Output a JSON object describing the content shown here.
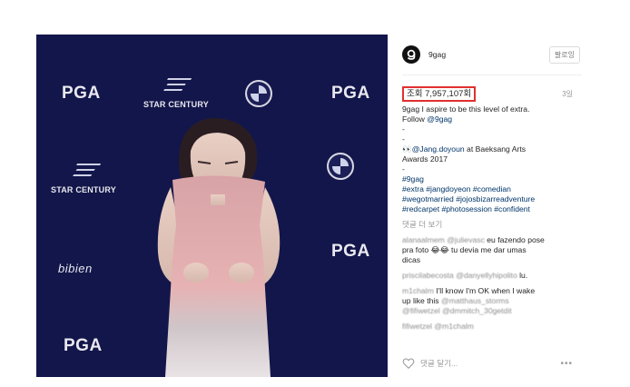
{
  "header": {
    "username": "9gag",
    "follow_label": "팔로잉"
  },
  "stats": {
    "views": "조회 7,957,107회",
    "time_ago": "3일"
  },
  "caption": {
    "author": "9gag",
    "text": "I aspire to be this level of extra.",
    "follow_prefix": "Follow",
    "follow_handle": "@9gag",
    "dash1": "-",
    "dash2": "-",
    "credit_icon": "👀",
    "credit_handle": "@Jang.doyoun",
    "credit_text": "at Baeksang Arts",
    "credit_text2": "Awards 2017",
    "dash3": "-",
    "tag_line1": "#9gag",
    "tag_line2": "#extra #jangdoyeon #comedian",
    "tag_line3": "#wegotmarried #jojosbizarreadventure",
    "tag_line4": "#redcarpet #photosession #confident"
  },
  "load_more": "댓글 더 보기",
  "comments": [
    {
      "user": "alanaalmem",
      "mention": "@julievasc",
      "text1": "eu fazendo pose",
      "text2": "pra foto 😂😂 tu devia me dar umas",
      "text3": "dicas"
    },
    {
      "user": "priscilabecosta",
      "mention": "@danyellyhipolito",
      "text1": "lu."
    },
    {
      "user": "m1chalm",
      "text1": "I'll know I'm OK when I wake",
      "text2": "up like this",
      "mention2": "@matthaus_storms",
      "line3": "@fifiwetzel @dmmitch_30getdit"
    },
    {
      "user": "fifiwetzel",
      "mention": "@m1chalm"
    }
  ],
  "footer": {
    "add_comment_placeholder": "댓글 달기...",
    "more_label": "•••"
  },
  "media": {
    "backdrop_logos": [
      "PGA",
      "STAR CENTURY",
      "bibien"
    ]
  },
  "colors": {
    "highlight_border": "#e0302f",
    "backdrop": "#13164a",
    "link": "#003569"
  }
}
